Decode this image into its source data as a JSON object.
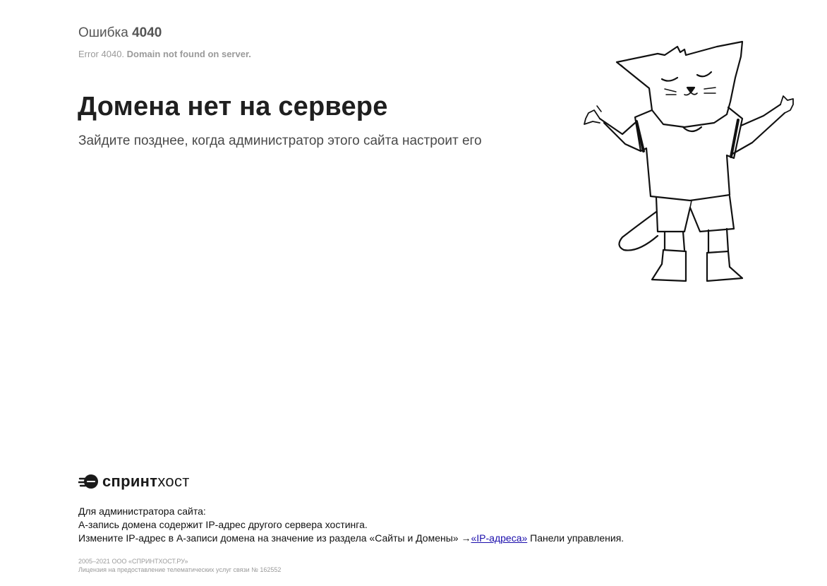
{
  "header": {
    "error_prefix": "Ошибка",
    "error_number": "4040",
    "desc_prefix": "Error 4040.",
    "desc_bold": "Domain not found on server."
  },
  "main": {
    "title": "Домена нет на сервере",
    "subtitle": "Зайдите позднее, когда администратор этого сайта настроит его"
  },
  "footer": {
    "logo": {
      "bold_part": "спринт",
      "light_part": "хост",
      "icon": "sprinthost-logo-icon"
    },
    "admin_heading": "Для администратора сайта:",
    "admin_line1": "A-запись домена содержит IP-адрес другого сервера хостинга.",
    "admin_line2_prefix": "Измените IP-адрес в A-записи домена на значение из раздела «Сайты и Домены» →",
    "admin_link": "«IP-адреса»",
    "admin_line2_suffix": " Панели управления.",
    "copyright": "2005–2021 ООО «СПРИНТХОСТ.РУ»",
    "license": "Лицензия на предоставление телематических услуг связи № 162552"
  },
  "illustration": {
    "name": "cat-shrugging-illustration"
  },
  "colors": {
    "link": "#1a0dab",
    "heading": "#1f1f1f",
    "muted": "#9a9a9a"
  }
}
